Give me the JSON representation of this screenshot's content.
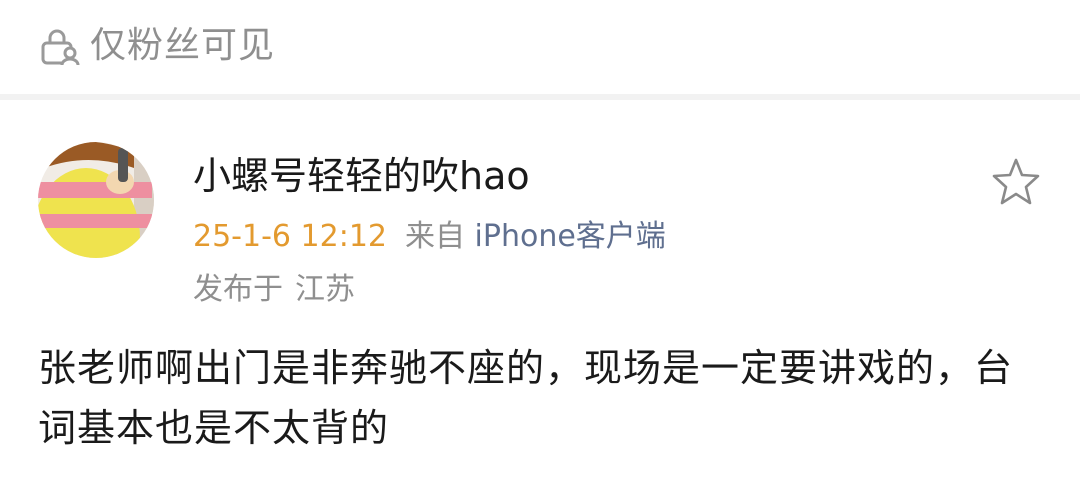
{
  "visibility": {
    "icon": "lock-people-icon",
    "label": "仅粉丝可见"
  },
  "post": {
    "author": {
      "name": "小螺号轻轻的吹hao",
      "avatar": "avatar-cartoon-yellow-striped"
    },
    "timestamp": "25-1-6 12:12",
    "source_prefix": "来自",
    "source_client": "iPhone客户端",
    "location_prefix": "发布于",
    "location": "江苏",
    "favorite_icon": "star-outline-icon",
    "text": "张老师啊出门是非奔驰不座的，现场是一定要讲戏的，台词基本也是不太背的"
  },
  "colors": {
    "timestamp": "#e39a2f",
    "secondary_text": "#8f8f8f",
    "client_link": "#5f6f8f",
    "primary_text": "#1a1a1a",
    "divider": "#f2f2f2"
  }
}
